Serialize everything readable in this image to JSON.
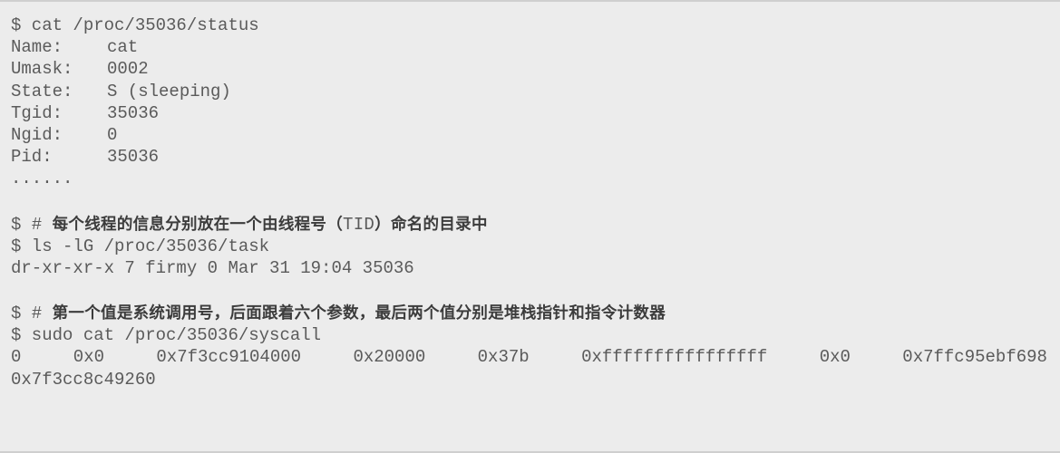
{
  "block1": {
    "command": "$ cat /proc/35036/status",
    "fields": [
      {
        "key": "Name:",
        "value": "cat"
      },
      {
        "key": "Umask:",
        "value": "0002"
      },
      {
        "key": "State:",
        "value": "S (sleeping)"
      },
      {
        "key": "Tgid:",
        "value": "35036"
      },
      {
        "key": "Ngid:",
        "value": "0"
      },
      {
        "key": "Pid:",
        "value": "35036"
      }
    ],
    "ellipsis": "......"
  },
  "block2": {
    "prompt": "$ #",
    "comment_before": "每个线程的信息分别放在一个由线程号（",
    "comment_mono": "TID",
    "comment_after": "）命名的目录中",
    "command": "$ ls -lG /proc/35036/task",
    "output": "dr-xr-xr-x 7 firmy 0 Mar 31 19:04 35036"
  },
  "block3": {
    "prompt": "$ #",
    "comment": "第一个值是系统调用号，后面跟着六个参数，最后两个值分别是堆栈指针和指令计数器",
    "command": "$ sudo cat /proc/35036/syscall",
    "values": [
      "0",
      "0x0",
      "0x7f3cc9104000",
      "0x20000",
      "0x37b",
      "0xffffffffffffffff",
      "0x0",
      "0x7ffc95ebf698"
    ],
    "last_value": "0x7f3cc8c49260"
  }
}
